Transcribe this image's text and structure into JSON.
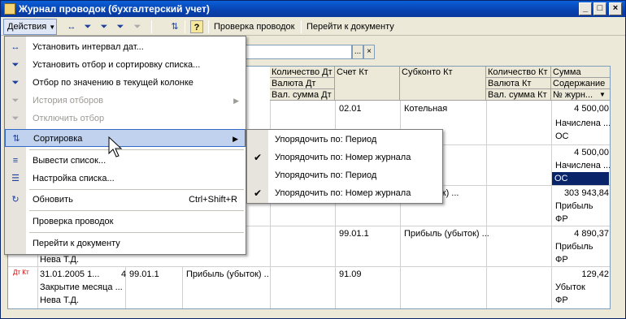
{
  "window": {
    "title": "Журнал проводок (бухгалтерский учет)"
  },
  "toolbar": {
    "actions_label": "Действия",
    "check_label": "Проверка проводок",
    "goto_label": "Перейти к документу"
  },
  "grid": {
    "headers_row1": [
      "Количество Дт",
      "Счет Кт",
      "Субконто Кт",
      "Количество Кт",
      "Сумма"
    ],
    "headers_row2": [
      "Валюта Дт",
      "Валюта Кт",
      "Содержание"
    ],
    "headers_row3": [
      "Вал. сумма Дт",
      "Вал. сумма Кт",
      "№ журн..."
    ],
    "rows": [
      {
        "acct_kt": "02.01",
        "subconto_kt": "Котельная",
        "sum": "4 500,00",
        "content": "Начислена ...",
        "extra": "ОС"
      },
      {
        "sum": "4 500,00",
        "content": "Начислена ...",
        "extra": "ОС"
      },
      {
        "subconto_kt": "... (убыток) ...",
        "sum": "303 943,84",
        "content": "Прибыль",
        "extra": "ФР"
      },
      {
        "acct_kt": "99.01.1",
        "subconto_kt": "Прибыль (убыток) ...",
        "sum": "4 890,37",
        "content": "Прибыль",
        "extra": "ФР",
        "person": "Нева Т.Д."
      },
      {
        "date": "31.01.2005 1...",
        "num": "4",
        "acct_dt": "99.01.1",
        "subconto_dt": "Прибыль (убыток) ...",
        "acct_kt": "91.09",
        "sum": "129,42",
        "content": "Убыток",
        "extra": "ФР",
        "desc": "Закрытие месяца ...",
        "person": "Нева Т.Д."
      }
    ],
    "row_icon_text": "Дт Кт"
  },
  "menu": {
    "items": [
      {
        "label": "Установить интервал дат...",
        "icon": "interval-icon"
      },
      {
        "label": "Установить отбор и сортировку списка...",
        "icon": "filter-sort-icon"
      },
      {
        "label": "Отбор по значению в текущей колонке",
        "icon": "filter-value-icon"
      },
      {
        "label": "История отборов",
        "icon": "filter-history-icon"
      },
      {
        "label": "Отключить отбор",
        "icon": "filter-off-icon"
      },
      {
        "label": "Сортировка",
        "icon": "sort-icon"
      },
      {
        "label": "Вывести список...",
        "icon": "print-list-icon"
      },
      {
        "label": "Настройка списка...",
        "icon": "list-settings-icon"
      },
      {
        "label": "Обновить",
        "icon": "refresh-icon",
        "shortcut": "Ctrl+Shift+R"
      },
      {
        "label": "Проверка проводок"
      },
      {
        "label": "Перейти к документу"
      }
    ]
  },
  "submenu": {
    "items": [
      {
        "label": "Упорядочить по:  Период",
        "checked": false
      },
      {
        "label": "Упорядочить по:  Номер журнала",
        "checked": true
      },
      {
        "label": "Упорядочить по:  Период",
        "checked": false
      },
      {
        "label": "Упорядочить по:  Номер журнала",
        "checked": true
      }
    ]
  }
}
